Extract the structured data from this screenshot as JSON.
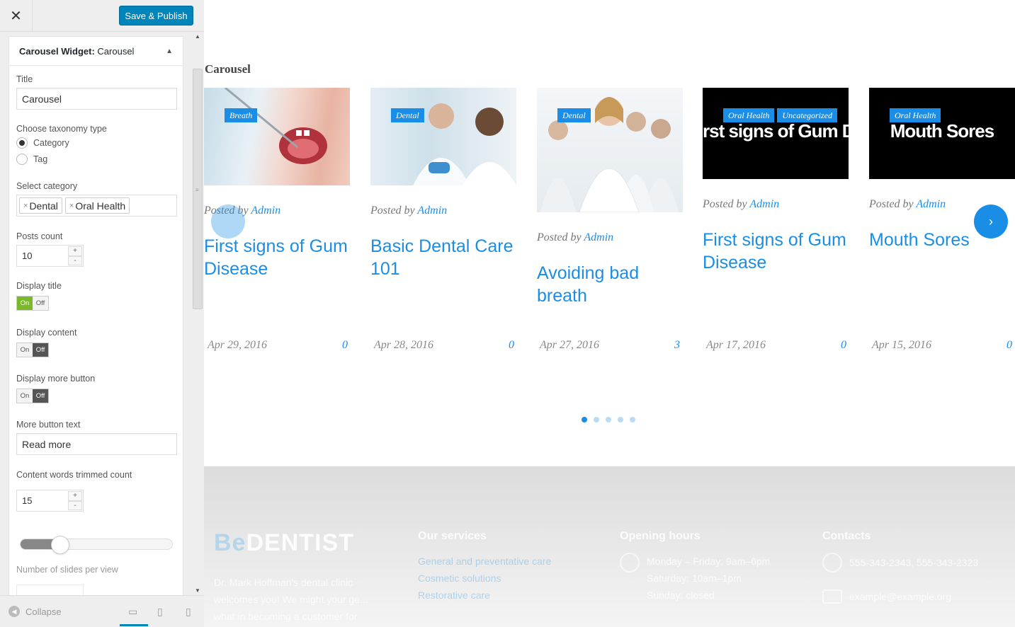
{
  "panel": {
    "close_label": "✕",
    "publish_label": "Save & Publish",
    "widget_title_prefix": "Carousel Widget:",
    "widget_title_name": "Carousel",
    "collapse_label": "Collapse"
  },
  "form": {
    "title_label": "Title",
    "title_value": "Carousel",
    "taxonomy_label": "Choose taxonomy type",
    "taxonomy_options": [
      "Category",
      "Tag"
    ],
    "taxonomy_selected": "Category",
    "category_label": "Select category",
    "categories": [
      "Dental",
      "Oral Health"
    ],
    "posts_count_label": "Posts count",
    "posts_count_value": "10",
    "display_title_label": "Display title",
    "display_title": "On",
    "display_content_label": "Display content",
    "display_content": "Off",
    "display_more_label": "Display more button",
    "display_more": "Off",
    "more_text_label": "More button text",
    "more_text_value": "Read more",
    "trim_label": "Content words trimmed count",
    "trim_value": "15",
    "slides_label": "Number of slides per view",
    "toggle_on": "On",
    "toggle_off": "Off",
    "slider_level_fraction": 0.2
  },
  "preview": {
    "section_title": "Carousel",
    "posted_by": "Posted by",
    "cards": [
      {
        "tags": [
          "Breath"
        ],
        "author": "Admin",
        "title": "First signs of Gum Disease",
        "date": "Apr 29, 2016",
        "comments": "0",
        "image": "open-mouth-photo"
      },
      {
        "tags": [
          "Dental"
        ],
        "author": "Admin",
        "title": "Basic Dental Care 101",
        "date": "Apr 28, 2016",
        "comments": "0",
        "image": "dentist-patient-photo"
      },
      {
        "tags": [
          "Dental"
        ],
        "author": "Admin",
        "title": "Avoiding bad breath",
        "date": "Apr 27, 2016",
        "comments": "3",
        "image": "medical-team-photo"
      },
      {
        "tags": [
          "Oral Health",
          "Uncategorized"
        ],
        "author": "Admin",
        "title": "First signs of Gum Disease",
        "date": "Apr 17, 2016",
        "comments": "0",
        "image": "black-banner",
        "banner_text": "rst signs of Gum Diseas"
      },
      {
        "tags": [
          "Oral Health"
        ],
        "author": "Admin",
        "title": "Mouth Sores",
        "date": "Apr 15, 2016",
        "comments": "0",
        "image": "black-banner",
        "banner_text": "Mouth Sores"
      }
    ],
    "dots": 5,
    "active_dot": 0
  },
  "footer": {
    "logo_be": "Be",
    "logo_main": "DENTIST",
    "about_text": "Dr. Mark Hoffman's dental clinic welcomes you! We might your ge... what in becoming a customer for",
    "services_title": "Our services",
    "services": [
      "General and preventative care",
      "Cosmetic solutions",
      "Restorative care"
    ],
    "hours_title": "Opening hours",
    "hours": [
      "Monday – Friday: 9am–6pm",
      "Saturday: 10am–1pm",
      "Sunday: closed"
    ],
    "contacts_title": "Contacts",
    "phone": "555-343-2343, 555-343-2323",
    "email": "example@example.org"
  },
  "colors": {
    "accent": "#1a8ee6",
    "publish": "#0085ba",
    "toggle_on": "#7ab929"
  }
}
